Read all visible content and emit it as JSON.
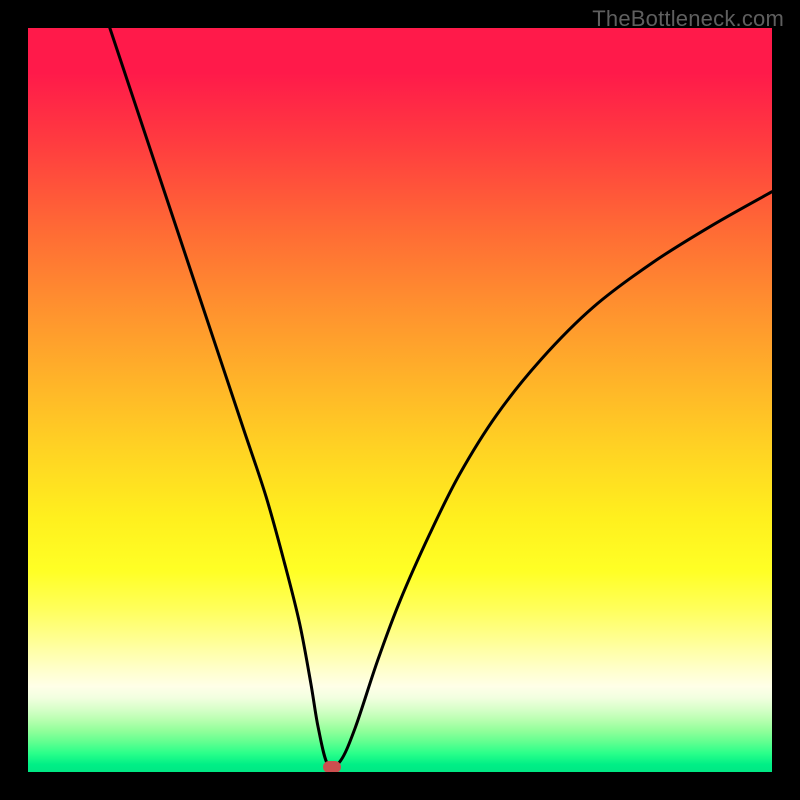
{
  "watermark": "TheBottleneck.com",
  "colors": {
    "page_bg": "#000000",
    "watermark_text": "#5f5f5f",
    "curve_stroke": "#000000",
    "marker_fill": "#cc4f4f"
  },
  "chart_data": {
    "type": "line",
    "title": "",
    "xlabel": "",
    "ylabel": "",
    "xlim": [
      0,
      100
    ],
    "ylim": [
      0,
      100
    ],
    "grid": false,
    "legend": false,
    "series": [
      {
        "name": "bottleneck-curve",
        "x": [
          11,
          14,
          17,
          20,
          23,
          26,
          29,
          32,
          34.5,
          36.5,
          38,
          39,
          40.3,
          42,
          44,
          47,
          50,
          54,
          58,
          63,
          69,
          76,
          84,
          92,
          100
        ],
        "y": [
          100,
          91,
          82,
          73,
          64,
          55,
          46,
          37,
          28,
          20,
          12,
          6,
          1,
          1.5,
          6,
          15,
          23,
          32,
          40,
          48,
          55.5,
          62.5,
          68.5,
          73.5,
          78
        ]
      }
    ],
    "annotations": [
      {
        "name": "marker-minimum",
        "x": 40.8,
        "y": 0.7
      }
    ],
    "background_gradient_stops": [
      {
        "pos": 0,
        "color": "#ff1a4a"
      },
      {
        "pos": 0.37,
        "color": "#ff8f2f"
      },
      {
        "pos": 0.66,
        "color": "#fff01e"
      },
      {
        "pos": 0.9,
        "color": "#f2ffe0"
      },
      {
        "pos": 1.0,
        "color": "#00e884"
      }
    ]
  }
}
